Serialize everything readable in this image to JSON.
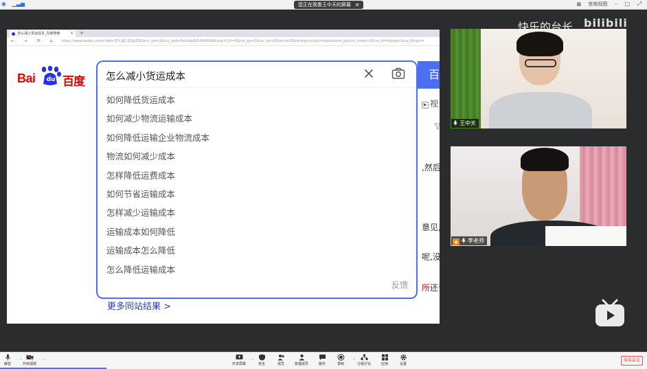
{
  "top_bar": {
    "share_status": "您正在观看王中天的屏幕",
    "share_menu_icon": "list-icon",
    "left_icons": [
      "shield-icon",
      "signal-icon"
    ],
    "layout_label": "宫格视图",
    "right_icons": [
      "layout-icon",
      "minimize-icon",
      "maximize-icon",
      "fullscreen-icon"
    ]
  },
  "browser": {
    "tab_title": "怎么减小货运成本_百度搜索",
    "new_tab": "+",
    "tab_close": "×",
    "nav_icons": "← → ⟳ ⌂",
    "url": "https://www.baidu.com/s?wd=怎么减小货运成本&rsv_spt=1&rsv_iqid=0xa3ab0d54000f98&issp=1&f=8&rsv_bp=1&rsv_idx=2&ie=utf-8&rqlang=cn&tn=baiduhome_pg&rsv_enter=1&rsv_dl=tb&oq=&rsv_btype=i"
  },
  "baidu": {
    "logo_bai": "Bai",
    "logo_du": "du",
    "logo_baidu": "百度",
    "search_query": "怎么减小货运成本",
    "search_button": "百度一下",
    "suggestions": [
      "如何降低货运成本",
      "如何减少物流运输成本",
      "如何降低运输企业物流成本",
      "物流如何减少成本",
      "怎样降低运费成本",
      "如何节省运输成本",
      "怎样减少运输成本",
      "运输成本如何降低",
      "运输成本怎么降低",
      "怎么降低运输成本"
    ],
    "feedback": "反馈",
    "more_results": "更多同站结果 >",
    "right_clips": {
      "video": "视",
      "line1": ",然后",
      "line2": "意见,",
      "line3": "呢,没",
      "line4_red": "所",
      "line4_rest": "还说"
    }
  },
  "participants": [
    {
      "name": "王中天",
      "host": false
    },
    {
      "name": "李老师",
      "host": true
    }
  ],
  "watermark": {
    "text": "快乐的台长",
    "logo": "bilibili"
  },
  "toolbar": {
    "left": [
      {
        "label": "静音",
        "icon": "mic-icon"
      },
      {
        "label": "开启视频",
        "icon": "video-off-icon"
      }
    ],
    "center": [
      {
        "label": "共享屏幕",
        "icon": "share-screen-icon"
      },
      {
        "label": "安全",
        "icon": "shield-icon"
      },
      {
        "label": "成员",
        "icon": "members-icon"
      },
      {
        "label": "管理成员",
        "icon": "manage-members-icon"
      },
      {
        "label": "聊天",
        "icon": "chat-icon"
      },
      {
        "label": "录制",
        "icon": "record-icon"
      },
      {
        "label": "分组讨论",
        "icon": "breakout-icon"
      },
      {
        "label": "应用",
        "icon": "apps-icon"
      },
      {
        "label": "设置",
        "icon": "settings-icon"
      }
    ],
    "end_button": "结束会议"
  },
  "colors": {
    "baidu_blue": "#4e6ef2",
    "baidu_red": "#e10601",
    "link_blue": "#2440b3",
    "end_red": "#e35151"
  }
}
